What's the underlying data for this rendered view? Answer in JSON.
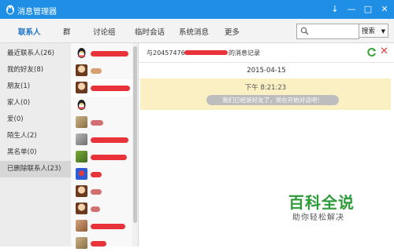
{
  "window": {
    "title": "消息管理器",
    "controls": [
      "↓",
      "—",
      "□",
      "✕"
    ]
  },
  "menu": {
    "tabs": [
      "联系人",
      "群",
      "讨论组",
      "临时会话",
      "系统消息",
      "更多"
    ],
    "active_tab": "联系人",
    "search_placeholder": "",
    "search_button": "搜索"
  },
  "sidebar": {
    "categories": [
      {
        "label": "最近联系人(26)"
      },
      {
        "label": "我的好友(8)"
      },
      {
        "label": "朋友(1)"
      },
      {
        "label": "家人(0)"
      },
      {
        "label": "爱(0)"
      },
      {
        "label": "陌生人(2)"
      },
      {
        "label": "黑名单(0)"
      },
      {
        "label": "已删除联系人(23)"
      }
    ],
    "selected_index": 7
  },
  "contacts": [
    {
      "avatar": "penguin"
    },
    {
      "avatar": "cartoon-girl"
    },
    {
      "avatar": "cartoon-girl"
    },
    {
      "avatar": "penguin"
    },
    {
      "avatar": "photo"
    },
    {
      "avatar": "photo"
    },
    {
      "avatar": "photo"
    },
    {
      "avatar": "cartoon"
    },
    {
      "avatar": "cartoon-girl"
    },
    {
      "avatar": "cartoon-girl"
    },
    {
      "avatar": "photo"
    },
    {
      "avatar": "photo"
    }
  ],
  "conversation": {
    "header_prefix": "与2045747604",
    "header_suffix": "的消息记录",
    "date": "2015-04-15",
    "messages": [
      {
        "time": "下午 8:21:23",
        "system_text": "我们已经是好友了，现在开始对话吧！"
      }
    ]
  },
  "watermark": {
    "title": "百科全说",
    "subtitle": "助你轻松解决"
  },
  "colors": {
    "titlebar": "#1f8fe6",
    "active_tab": "#1b72c8",
    "message_bg": "#fbefc4",
    "redaction": "#e8333a",
    "watermark": "#2e9b3a"
  }
}
